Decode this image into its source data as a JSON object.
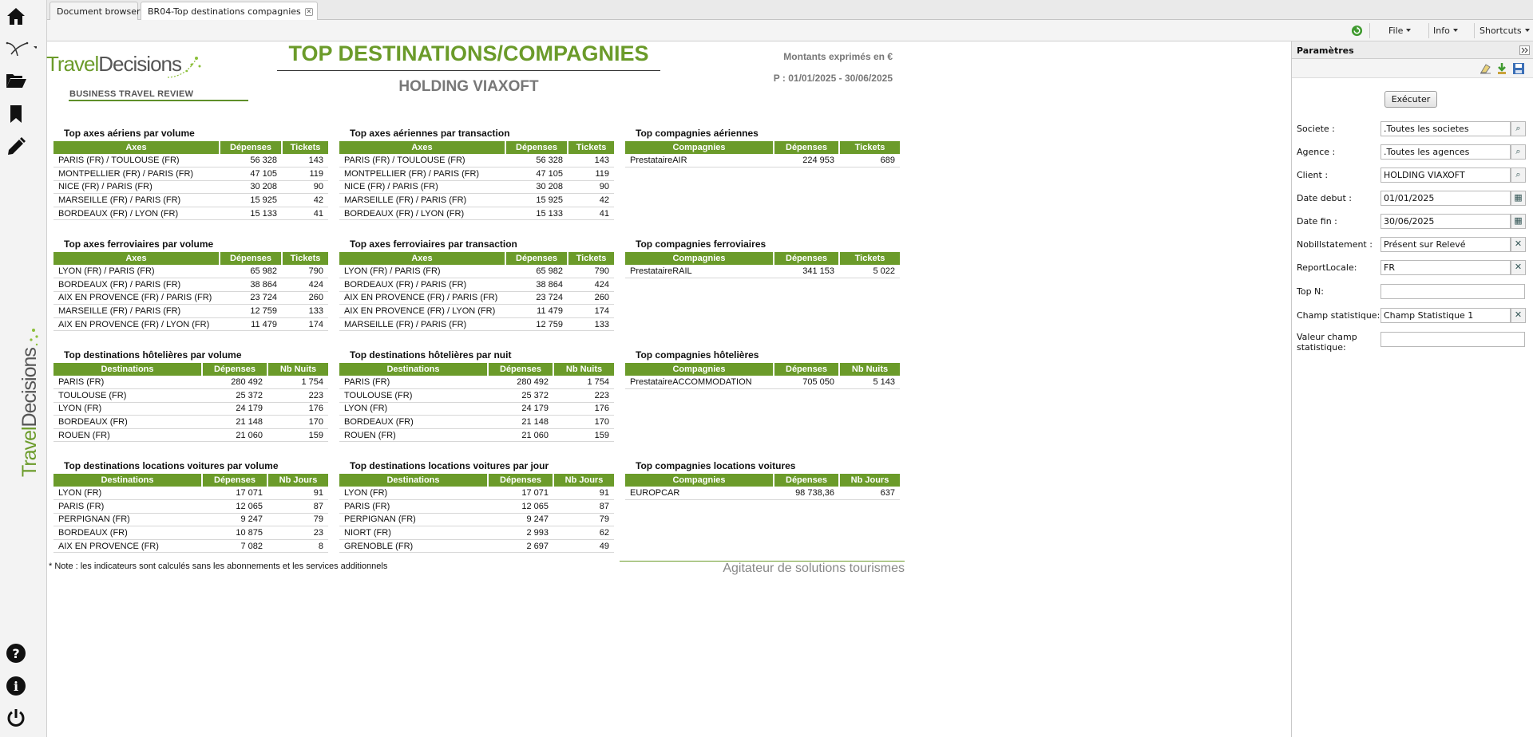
{
  "tabs": [
    {
      "label": "Document browser"
    },
    {
      "label": "BR04-Top destinations compagnies"
    }
  ],
  "toolbar": {
    "file": "File",
    "info": "Info",
    "shortcuts": "Shortcuts"
  },
  "report": {
    "logo_travel": "Travel",
    "logo_decisions": "Decisions",
    "logo_sub": "BUSINESS TRAVEL REVIEW",
    "title": "TOP DESTINATIONS/COMPAGNIES",
    "subtitle": "HOLDING VIAXOFT",
    "amounts_note": "Montants exprimés en €",
    "period": "P : 01/01/2025 - 30/06/2025",
    "note": "* Note : les indicateurs sont calculés sans les abonnements et les services additionnels",
    "tagline": "Agitateur de solutions tourismes"
  },
  "tables": [
    {
      "title": "Top axes aériens par volume",
      "headers": [
        "Axes",
        "Dépenses",
        "Tickets"
      ],
      "rows": [
        [
          "PARIS (FR) / TOULOUSE (FR)",
          "56 328",
          "143"
        ],
        [
          "MONTPELLIER (FR) / PARIS (FR)",
          "47 105",
          "119"
        ],
        [
          "NICE (FR) / PARIS (FR)",
          "30 208",
          "90"
        ],
        [
          "MARSEILLE (FR) / PARIS (FR)",
          "15 925",
          "42"
        ],
        [
          "BORDEAUX (FR) / LYON (FR)",
          "15 133",
          "41"
        ]
      ]
    },
    {
      "title": "Top axes aériennes par transaction",
      "headers": [
        "Axes",
        "Dépenses",
        "Tickets"
      ],
      "rows": [
        [
          "PARIS (FR) / TOULOUSE (FR)",
          "56 328",
          "143"
        ],
        [
          "MONTPELLIER (FR) / PARIS (FR)",
          "47 105",
          "119"
        ],
        [
          "NICE (FR) / PARIS (FR)",
          "30 208",
          "90"
        ],
        [
          "MARSEILLE (FR) / PARIS (FR)",
          "15 925",
          "42"
        ],
        [
          "BORDEAUX (FR) / LYON (FR)",
          "15 133",
          "41"
        ]
      ]
    },
    {
      "title": "Top compagnies aériennes",
      "headers": [
        "Compagnies",
        "Dépenses",
        "Tickets"
      ],
      "rows": [
        [
          "PrestataireAIR",
          "224 953",
          "689"
        ]
      ]
    },
    {
      "title": "Top axes ferroviaires par volume",
      "headers": [
        "Axes",
        "Dépenses",
        "Tickets"
      ],
      "rows": [
        [
          "LYON (FR) / PARIS (FR)",
          "65 982",
          "790"
        ],
        [
          "BORDEAUX (FR) / PARIS (FR)",
          "38 864",
          "424"
        ],
        [
          "AIX EN PROVENCE (FR) / PARIS (FR)",
          "23 724",
          "260"
        ],
        [
          "MARSEILLE (FR) / PARIS (FR)",
          "12 759",
          "133"
        ],
        [
          "AIX EN PROVENCE (FR) / LYON (FR)",
          "11 479",
          "174"
        ]
      ]
    },
    {
      "title": "Top axes ferroviaires par transaction",
      "headers": [
        "Axes",
        "Dépenses",
        "Tickets"
      ],
      "rows": [
        [
          "LYON (FR) / PARIS (FR)",
          "65 982",
          "790"
        ],
        [
          "BORDEAUX (FR) / PARIS (FR)",
          "38 864",
          "424"
        ],
        [
          "AIX EN PROVENCE (FR) / PARIS (FR)",
          "23 724",
          "260"
        ],
        [
          "AIX EN PROVENCE (FR) / LYON (FR)",
          "11 479",
          "174"
        ],
        [
          "MARSEILLE (FR) / PARIS (FR)",
          "12 759",
          "133"
        ]
      ]
    },
    {
      "title": "Top compagnies ferroviaires",
      "headers": [
        "Compagnies",
        "Dépenses",
        "Tickets"
      ],
      "rows": [
        [
          "PrestataireRAIL",
          "341 153",
          "5 022"
        ]
      ]
    },
    {
      "title": "Top destinations hôtelières par volume",
      "headers": [
        "Destinations",
        "Dépenses",
        "Nb Nuits"
      ],
      "rows": [
        [
          "PARIS (FR)",
          "280 492",
          "1 754"
        ],
        [
          "TOULOUSE (FR)",
          "25 372",
          "223"
        ],
        [
          "LYON (FR)",
          "24 179",
          "176"
        ],
        [
          "BORDEAUX (FR)",
          "21 148",
          "170"
        ],
        [
          "ROUEN (FR)",
          "21 060",
          "159"
        ]
      ]
    },
    {
      "title": "Top destinations hôtelières par nuit",
      "headers": [
        "Destinations",
        "Dépenses",
        "Nb Nuits"
      ],
      "rows": [
        [
          "PARIS (FR)",
          "280 492",
          "1 754"
        ],
        [
          "TOULOUSE (FR)",
          "25 372",
          "223"
        ],
        [
          "LYON (FR)",
          "24 179",
          "176"
        ],
        [
          "BORDEAUX (FR)",
          "21 148",
          "170"
        ],
        [
          "ROUEN (FR)",
          "21 060",
          "159"
        ]
      ]
    },
    {
      "title": "Top compagnies hôtelières",
      "headers": [
        "Compagnies",
        "Dépenses",
        "Nb Nuits"
      ],
      "rows": [
        [
          "PrestataireACCOMMODATION",
          "705 050",
          "5 143"
        ]
      ]
    },
    {
      "title": "Top destinations locations voitures par volume",
      "headers": [
        "Destinations",
        "Dépenses",
        "Nb Jours"
      ],
      "rows": [
        [
          "LYON (FR)",
          "17 071",
          "91"
        ],
        [
          "PARIS (FR)",
          "12 065",
          "87"
        ],
        [
          "PERPIGNAN (FR)",
          "9 247",
          "79"
        ],
        [
          "BORDEAUX (FR)",
          "10 875",
          "23"
        ],
        [
          "AIX EN PROVENCE (FR)",
          "7 082",
          "8"
        ]
      ]
    },
    {
      "title": "Top destinations locations voitures par jour",
      "headers": [
        "Destinations",
        "Dépenses",
        "Nb Jours"
      ],
      "rows": [
        [
          "LYON (FR)",
          "17 071",
          "91"
        ],
        [
          "PARIS (FR)",
          "12 065",
          "87"
        ],
        [
          "PERPIGNAN (FR)",
          "9 247",
          "79"
        ],
        [
          "NIORT (FR)",
          "2 993",
          "62"
        ],
        [
          "GRENOBLE (FR)",
          "2 697",
          "49"
        ]
      ]
    },
    {
      "title": "Top compagnies locations voitures",
      "headers": [
        "Compagnies",
        "Dépenses",
        "Nb Jours"
      ],
      "rows": [
        [
          "EUROPCAR",
          "98 738,36",
          "637"
        ]
      ]
    }
  ],
  "params": {
    "title": "Paramètres",
    "execute": "Exécuter",
    "fields": [
      {
        "label": "Societe :",
        "value": ".Toutes les societes",
        "button": "search-icon"
      },
      {
        "label": "Agence :",
        "value": ".Toutes les agences",
        "button": "search-icon"
      },
      {
        "label": "Client :",
        "value": "HOLDING VIAXOFT",
        "button": "search-icon"
      },
      {
        "label": "Date debut :",
        "value": "01/01/2025",
        "button": "calendar-icon"
      },
      {
        "label": "Date fin :",
        "value": "30/06/2025",
        "button": "calendar-icon"
      },
      {
        "label": "Nobillstatement :",
        "value": "Présent sur Relevé",
        "button": "clear-icon"
      },
      {
        "label": "ReportLocale:",
        "value": "FR",
        "button": "clear-icon"
      },
      {
        "label": "Top N:",
        "value": "",
        "button": ""
      },
      {
        "label": "Champ statistique:",
        "value": "Champ Statistique 1",
        "button": "clear-icon"
      },
      {
        "label": "Valeur champ statistique:",
        "value": "",
        "button": ""
      }
    ]
  },
  "colors": {
    "accent": "#6b9b2a"
  }
}
